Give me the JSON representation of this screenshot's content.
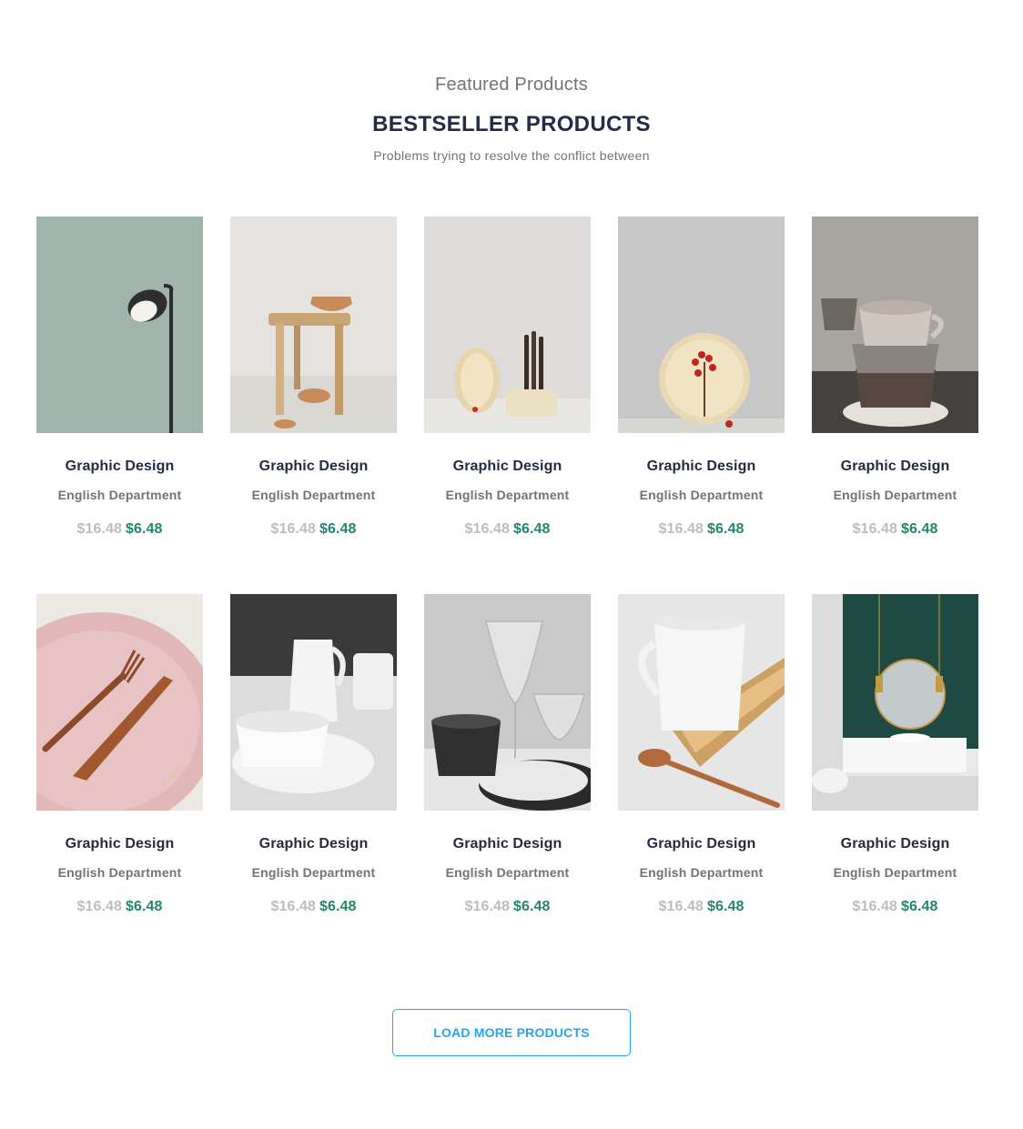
{
  "header": {
    "eyebrow": "Featured Products",
    "title": "BESTSELLER PRODUCTS",
    "subtitle": "Problems trying to resolve the conflict between"
  },
  "products": [
    {
      "name": "Graphic Design",
      "department": "English Department",
      "old_price": "$16.48",
      "new_price": "$6.48",
      "image": "floor-lamp"
    },
    {
      "name": "Graphic Design",
      "department": "English Department",
      "old_price": "$16.48",
      "new_price": "$6.48",
      "image": "wooden-stool"
    },
    {
      "name": "Graphic Design",
      "department": "English Department",
      "old_price": "$16.48",
      "new_price": "$6.48",
      "image": "cutlery-holder"
    },
    {
      "name": "Graphic Design",
      "department": "English Department",
      "old_price": "$16.48",
      "new_price": "$6.48",
      "image": "plate-with-berries"
    },
    {
      "name": "Graphic Design",
      "department": "English Department",
      "old_price": "$16.48",
      "new_price": "$6.48",
      "image": "stacked-cups"
    },
    {
      "name": "Graphic Design",
      "department": "English Department",
      "old_price": "$16.48",
      "new_price": "$6.48",
      "image": "copper-cutlery"
    },
    {
      "name": "Graphic Design",
      "department": "English Department",
      "old_price": "$16.48",
      "new_price": "$6.48",
      "image": "white-tableware"
    },
    {
      "name": "Graphic Design",
      "department": "English Department",
      "old_price": "$16.48",
      "new_price": "$6.48",
      "image": "glassware"
    },
    {
      "name": "Graphic Design",
      "department": "English Department",
      "old_price": "$16.48",
      "new_price": "$6.48",
      "image": "mug-and-spoon"
    },
    {
      "name": "Graphic Design",
      "department": "English Department",
      "old_price": "$16.48",
      "new_price": "$6.48",
      "image": "bathroom"
    }
  ],
  "load_more_label": "LOAD MORE PRODUCTS",
  "colors": {
    "heading": "#252b42",
    "muted": "#737373",
    "old_price": "#bdbdbd",
    "new_price": "#23856d",
    "accent": "#23a6f0"
  }
}
